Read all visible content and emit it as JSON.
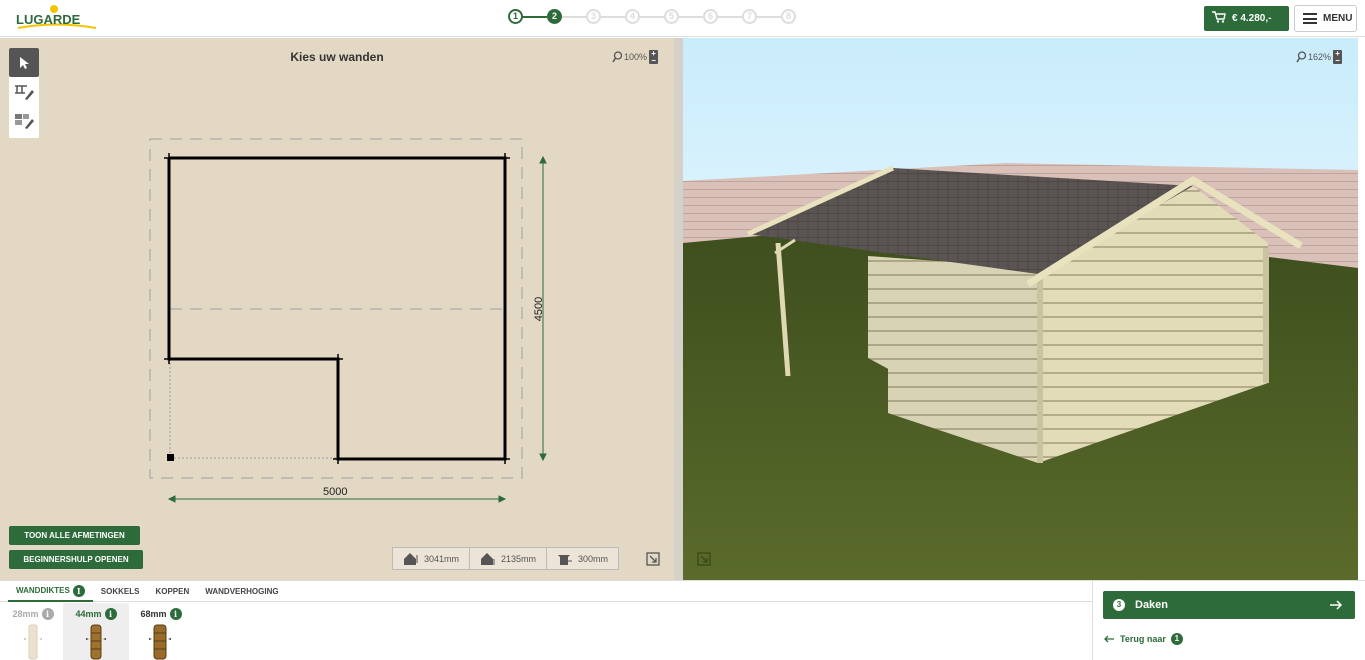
{
  "header": {
    "logo_text": "LUGARDE",
    "steps": [
      "1",
      "2",
      "3",
      "4",
      "5",
      "6",
      "7",
      "8"
    ],
    "current_step": 2,
    "cart_price": "€ 4.280,-",
    "menu_label": "MENU"
  },
  "panel2d": {
    "title": "Kies uw wanden",
    "zoom": "100%",
    "dim_width": "5000",
    "dim_depth": "4500",
    "btn_show_dimensions": "TOON ALLE AFMETINGEN",
    "btn_beginner_help": "BEGINNERSHULP OPENEN",
    "measurements": [
      "3041mm",
      "2135mm",
      "300mm"
    ]
  },
  "panel3d": {
    "zoom": "162%"
  },
  "bottom": {
    "tabs": [
      "WANDDIKTES",
      "SOKKELS",
      "KOPPEN",
      "WANDVERHOGING"
    ],
    "active_tab": "WANDDIKTES",
    "thicknesses": [
      "28mm",
      "44mm",
      "68mm"
    ],
    "selected_thickness": "44mm",
    "next_step_number": "3",
    "next_step_label": "Daken",
    "back_label": "Terug naar",
    "back_step": "1"
  },
  "colors": {
    "brand_green": "#2e6b3b",
    "plan_background": "#e3d8c4",
    "sky": "#cdeefc",
    "grass": "#4a5a22"
  }
}
